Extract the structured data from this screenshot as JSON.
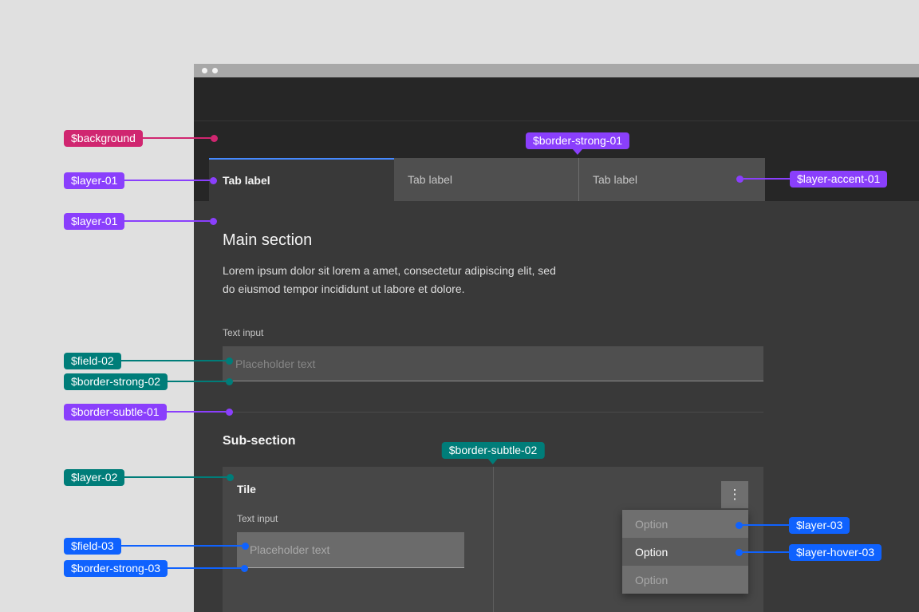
{
  "colors": {
    "canvas": "#e0e0e0",
    "titlebar": "#a8a8a8",
    "background": "#262626",
    "layer_01": "#393939",
    "layer_accent_01": "#4f4f4f",
    "layer_02": "#474747",
    "layer_03": "#6f6f6f",
    "layer_hover_03": "#5c5c5c",
    "field_02": "#4f4f4f",
    "field_03": "#6b6b6b",
    "border_subtle_01": "#4b4b4b",
    "border_subtle_02": "#5e5e5e",
    "border_strong_01": "#6f6f6f",
    "border_strong_02": "#8d8d8d",
    "border_strong_03": "#a8a8a8",
    "tab_selected_accent": "#4589ff",
    "badge_magenta": "#d02670",
    "badge_purple": "#8a3ffc",
    "badge_teal": "#007d79",
    "badge_blue": "#0f62fe"
  },
  "tabs": [
    {
      "label": "Tab label",
      "selected": true
    },
    {
      "label": "Tab label",
      "selected": false
    },
    {
      "label": "Tab label",
      "selected": false
    }
  ],
  "main": {
    "heading": "Main section",
    "body": "Lorem ipsum dolor sit lorem a amet, consectetur adipiscing elit, sed do eiusmod tempor incididunt ut labore et dolore.",
    "input_label": "Text input",
    "input_placeholder": "Placeholder text"
  },
  "subsection": {
    "heading": "Sub-section",
    "tile": {
      "title": "Tile",
      "input_label": "Text input",
      "input_placeholder": "Placeholder text",
      "overflow_icon": "⋮"
    },
    "menu": {
      "options": [
        {
          "label": "Option",
          "state": "normal"
        },
        {
          "label": "Option",
          "state": "hovered"
        },
        {
          "label": "Option",
          "state": "normal"
        }
      ]
    }
  },
  "annotations": {
    "left": [
      {
        "label": "$background"
      },
      {
        "label": "$layer-01"
      },
      {
        "label": "$layer-01"
      },
      {
        "label": "$field-02"
      },
      {
        "label": "$border-strong-02"
      },
      {
        "label": "$border-subtle-01"
      },
      {
        "label": "$layer-02"
      },
      {
        "label": "$field-03"
      },
      {
        "label": "$border-strong-03"
      }
    ],
    "tooltip": [
      {
        "label": "$border-strong-01"
      },
      {
        "label": "$border-subtle-02"
      }
    ],
    "right": [
      {
        "label": "$layer-accent-01"
      },
      {
        "label": "$layer-03"
      },
      {
        "label": "$layer-hover-03"
      }
    ]
  }
}
